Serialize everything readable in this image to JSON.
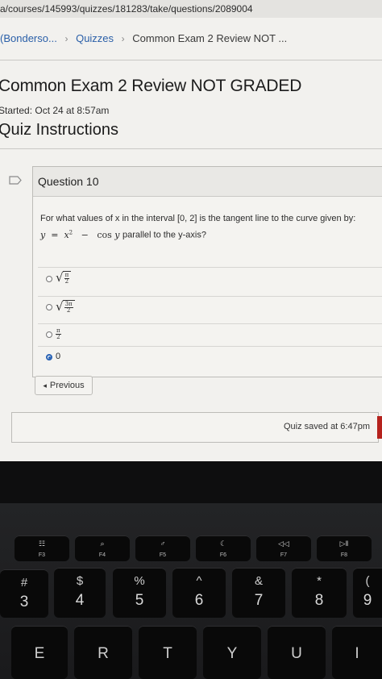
{
  "browser": {
    "url": "a/courses/145993/quizzes/181283/take/questions/2089004"
  },
  "breadcrumb": {
    "course": "(Bonderso...",
    "quizzes": "Quizzes",
    "current": "Common Exam 2 Review NOT ..."
  },
  "quiz": {
    "title": "Common Exam 2 Review NOT GRADED",
    "started": "Started: Oct 24 at 8:57am",
    "instructions_heading": "Quiz Instructions"
  },
  "question": {
    "title": "Question 10",
    "prompt": "For what values of x in the interval [0, 2] is the tangent line to the curve given by:",
    "equation": {
      "lhs": "y",
      "eq": "=",
      "x": "x",
      "exp": "2",
      "minus": "−",
      "cos": "cos",
      "var": "y"
    },
    "prompt_end": "parallel to the y-axis?",
    "options": [
      {
        "num": "π",
        "den": "2",
        "radical": true,
        "checked": false
      },
      {
        "num": "3π",
        "den": "2",
        "radical": true,
        "checked": false
      },
      {
        "num": "π",
        "den": "2",
        "radical": false,
        "checked": false
      },
      {
        "text": "0",
        "checked": true
      }
    ]
  },
  "nav": {
    "previous_arrow": "◂",
    "previous_label": "Previous"
  },
  "status": {
    "saved": "Quiz saved at 6:47pm"
  },
  "keyboard": {
    "fn_keys": [
      {
        "icon": "☷",
        "label": "F3"
      },
      {
        "icon": "⌕",
        "label": "F4"
      },
      {
        "icon": "♂",
        "label": "F5"
      },
      {
        "icon": "☾",
        "label": "F6"
      },
      {
        "icon": "◁◁",
        "label": "F7"
      },
      {
        "icon": "▷‖",
        "label": "F8"
      }
    ],
    "num_keys": [
      {
        "top": "#",
        "bottom": "3"
      },
      {
        "top": "$",
        "bottom": "4"
      },
      {
        "top": "%",
        "bottom": "5"
      },
      {
        "top": "^",
        "bottom": "6"
      },
      {
        "top": "&",
        "bottom": "7"
      },
      {
        "top": "*",
        "bottom": "8"
      },
      {
        "top": "(",
        "bottom": "9"
      }
    ],
    "letter_keys": [
      "E",
      "R",
      "T",
      "Y",
      "U",
      "I"
    ]
  },
  "colors": {
    "link": "#2a5fa8",
    "radio_checked": "#2a63b5",
    "accent_red": "#b5221d"
  }
}
